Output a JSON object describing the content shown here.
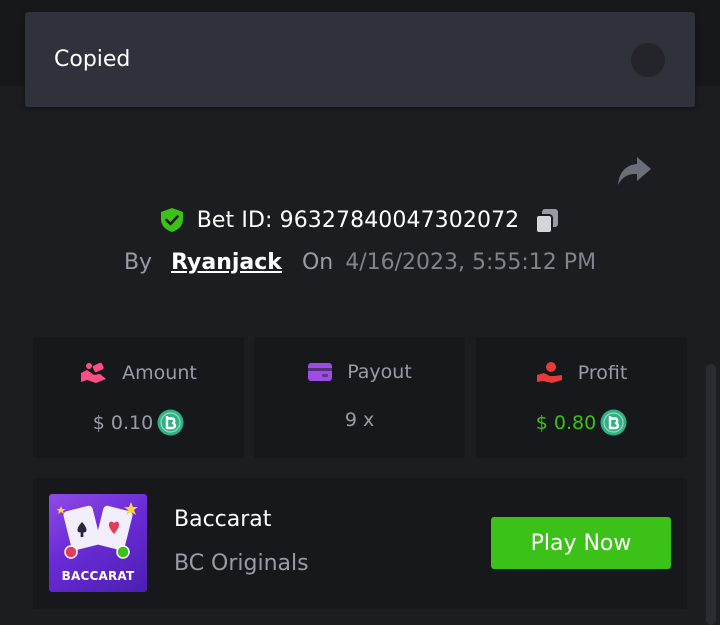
{
  "toast": {
    "message": "Copied"
  },
  "bet": {
    "id_text": "Bet ID: 96327840047302072",
    "by_label": "By",
    "username": "Ryanjack",
    "on_label": "On",
    "timestamp": "4/16/2023, 5:55:12 PM"
  },
  "stats": [
    {
      "label": "Amount",
      "value": "$ 0.10",
      "icon": "hand-coins-icon",
      "color": "#ff4d86",
      "value_color": "#989ca6",
      "coin": true
    },
    {
      "label": "Payout",
      "value": "9 x",
      "icon": "wallet-card-icon",
      "color": "#9b4de6",
      "value_color": "#989ca6",
      "coin": false
    },
    {
      "label": "Profit",
      "value": "$ 0.80",
      "icon": "hand-money-icon",
      "color": "#e83a3a",
      "value_color": "#3bc117",
      "coin": true
    }
  ],
  "game": {
    "thumbnail_text": "BACCARAT",
    "title": "Baccarat",
    "provider": "BC Originals",
    "play_label": "Play Now"
  },
  "colors": {
    "accent_green": "#3bc117",
    "shield_green": "#3bc117",
    "coin_teal": "#2fb283",
    "background": "#1c1d21",
    "card": "#17181b"
  }
}
